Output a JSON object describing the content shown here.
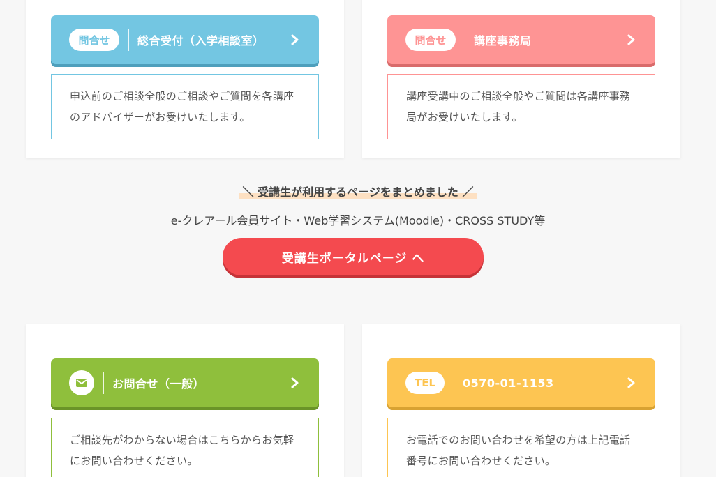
{
  "colors": {
    "blue": "#73c6e2",
    "pink": "#fe9494",
    "green": "#8fbf3c",
    "yellow": "#fdc552",
    "portal_red": "#f44a4f"
  },
  "cards": [
    {
      "badge": "問合せ",
      "label": "総合受付（入学相談室）",
      "description": "申込前のご相談全般のご相談やご質問を各講座のアドバイザーがお受けいたします。"
    },
    {
      "badge": "問合せ",
      "label": "講座事務局",
      "description": "講座受講中のご相談全般やご質問は各講座事務局がお受けいたします。"
    },
    {
      "badge_icon": "mail-icon",
      "label": "お問合せ（一般）",
      "description": "ご相談先がわからない場合はこちらからお気軽にお問い合わせください。"
    },
    {
      "badge": "TEL",
      "label": "0570-01-1153",
      "description": "お電話でのお問い合わせを希望の方は上記電話番号にお問い合わせください。"
    }
  ],
  "portal": {
    "heading": "＼ 受講生が利用するページをまとめました ／",
    "subtext": "e-クレアール会員サイト・Web学習システム(Moodle)・CROSS STUDY等",
    "button_label": "受講生ポータルページ へ"
  }
}
